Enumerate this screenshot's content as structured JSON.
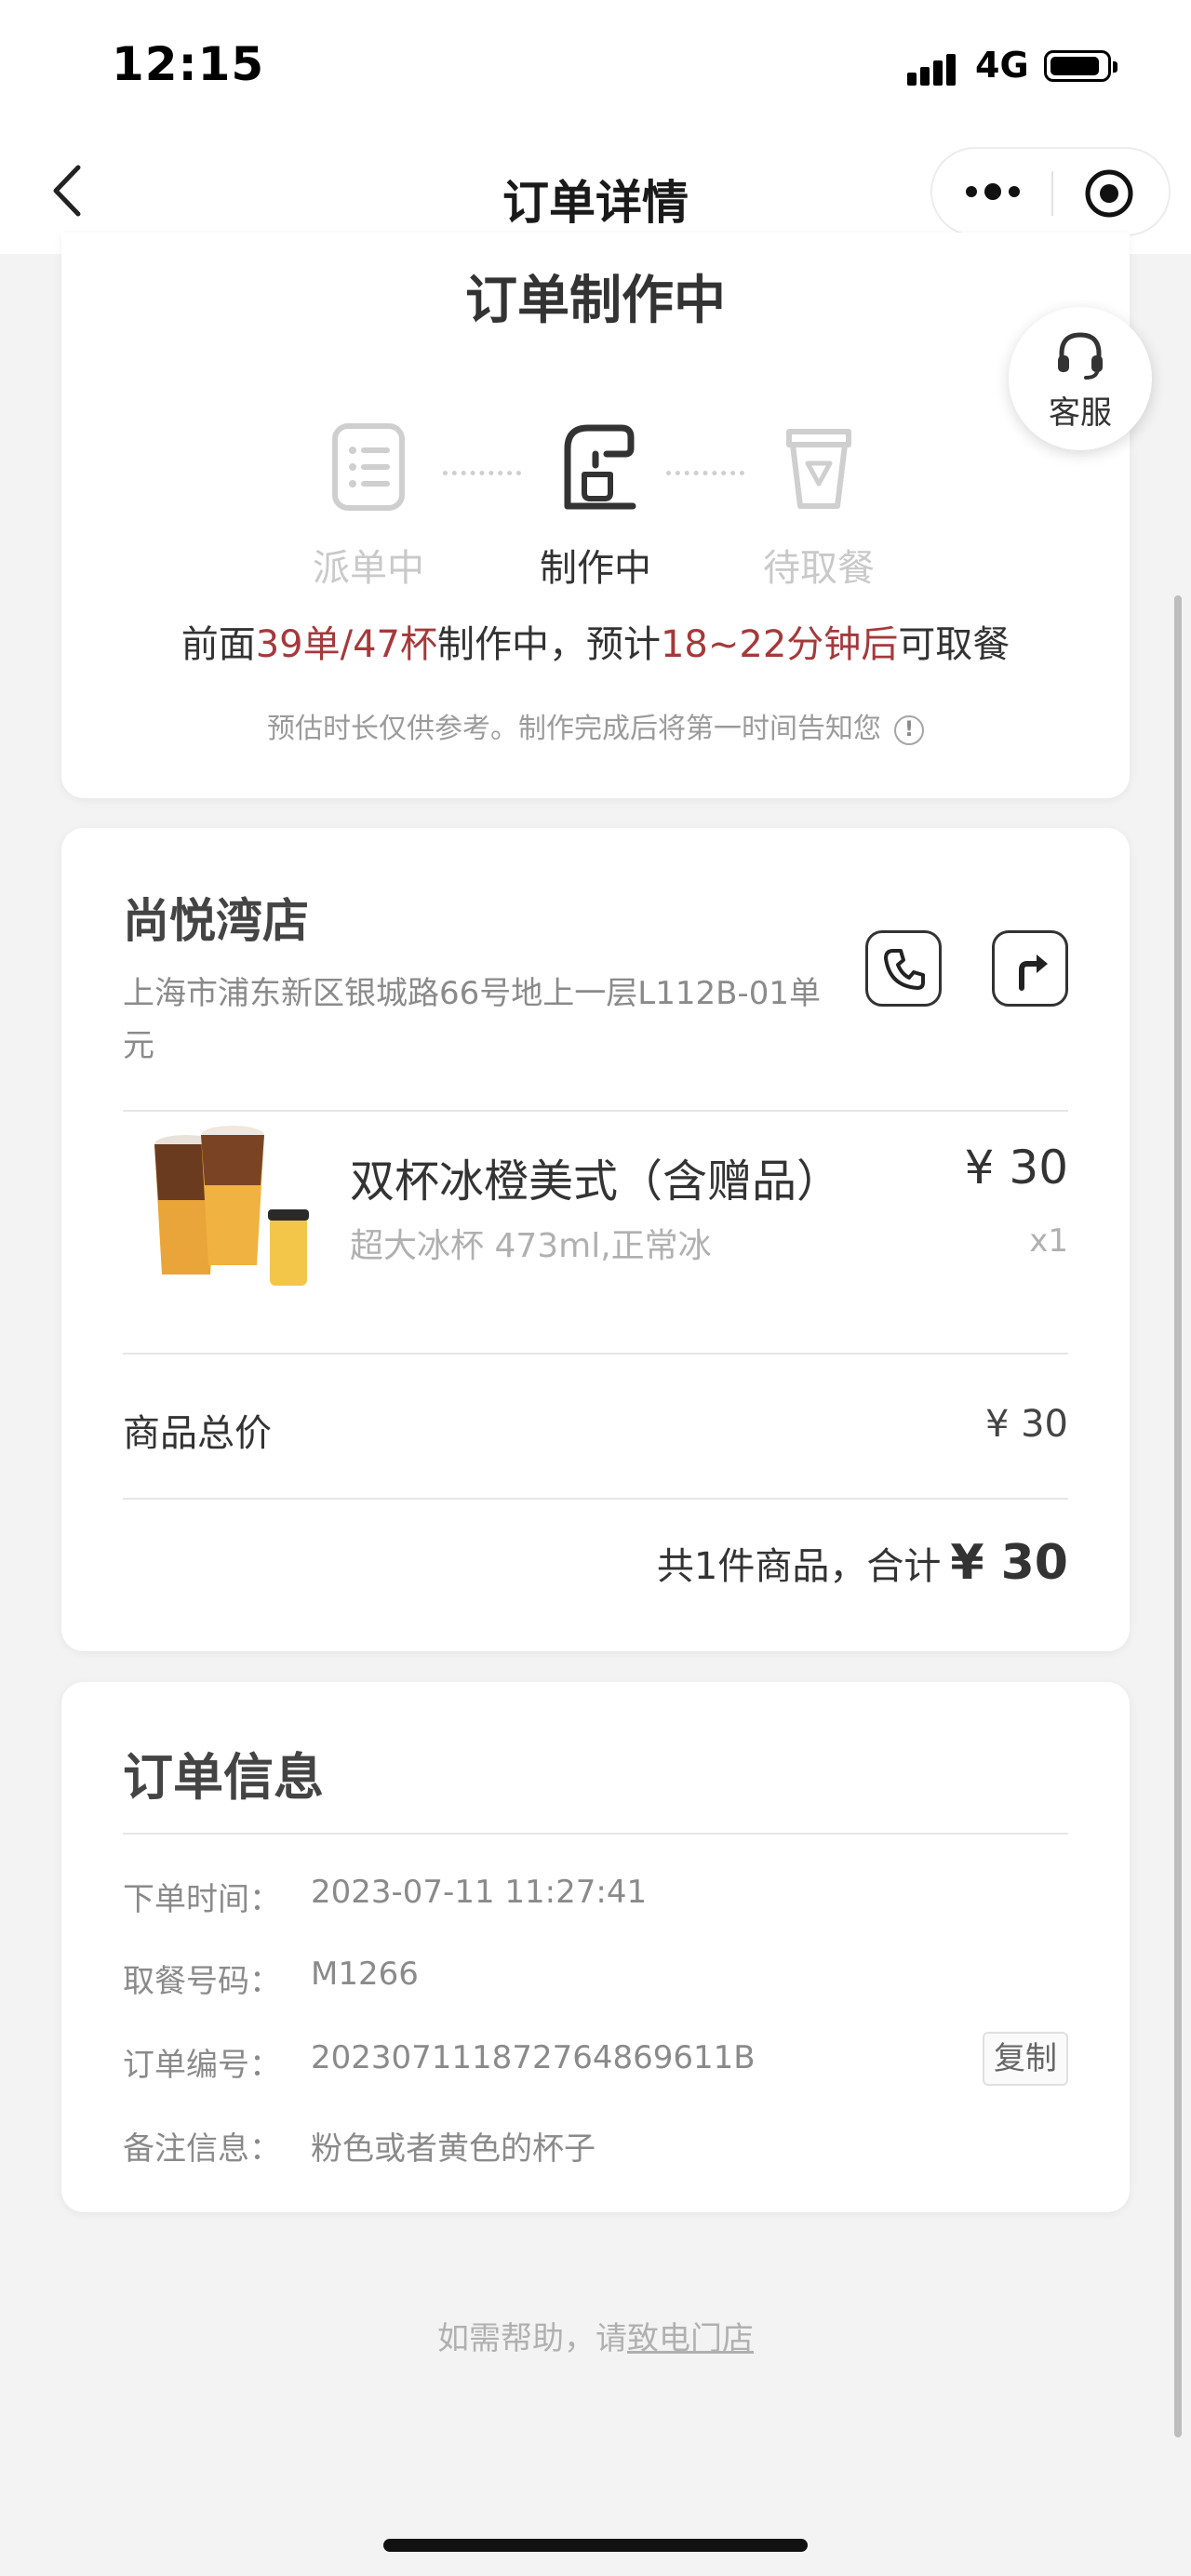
{
  "status_bar": {
    "time": "12:15",
    "network": "4G"
  },
  "nav": {
    "title": "订单详情"
  },
  "order_status": {
    "title": "订单制作中",
    "steps": [
      {
        "label": "派单中",
        "icon": "list-icon",
        "state": "done"
      },
      {
        "label": "制作中",
        "icon": "coffee-machine-icon",
        "state": "active"
      },
      {
        "label": "待取餐",
        "icon": "cup-icon",
        "state": "pending"
      }
    ],
    "queue": {
      "prefix": "前面",
      "count": "39单/47杯",
      "middle": "制作中，预计",
      "eta": "18~22分钟后",
      "suffix": "可取餐"
    },
    "note": "预估时长仅供参考。制作完成后将第一时间告知您",
    "info_icon": "!"
  },
  "service": {
    "label": "客服"
  },
  "store": {
    "name": "尚悦湾店",
    "address": "上海市浦东新区银城路66号地上一层L112B-01单元"
  },
  "product": {
    "name": "双杯冰橙美式（含赠品）",
    "spec": "超大冰杯 473ml,正常冰",
    "price": "¥ 30",
    "qty": "x1"
  },
  "summary": {
    "subtotal_label": "商品总价",
    "subtotal_value": "¥ 30",
    "total_prefix": "共1件商品，合计",
    "total_amount": "¥ 30"
  },
  "order_info": {
    "title": "订单信息",
    "rows": [
      {
        "key": "下单时间：",
        "value": "2023-07-11 11:27:41"
      },
      {
        "key": "取餐号码：",
        "value": "M1266"
      },
      {
        "key": "订单编号：",
        "value": "20230711187276486961​1B"
      },
      {
        "key": "备注信息：",
        "value": "粉色或者黄色的杯子"
      }
    ],
    "copy_label": "复制"
  },
  "help": {
    "prefix": "如需帮助，请",
    "link": "致电门店"
  },
  "colors": {
    "accent": "#a5393b",
    "muted": "#8a8a8a",
    "background": "#f3f3f3"
  }
}
